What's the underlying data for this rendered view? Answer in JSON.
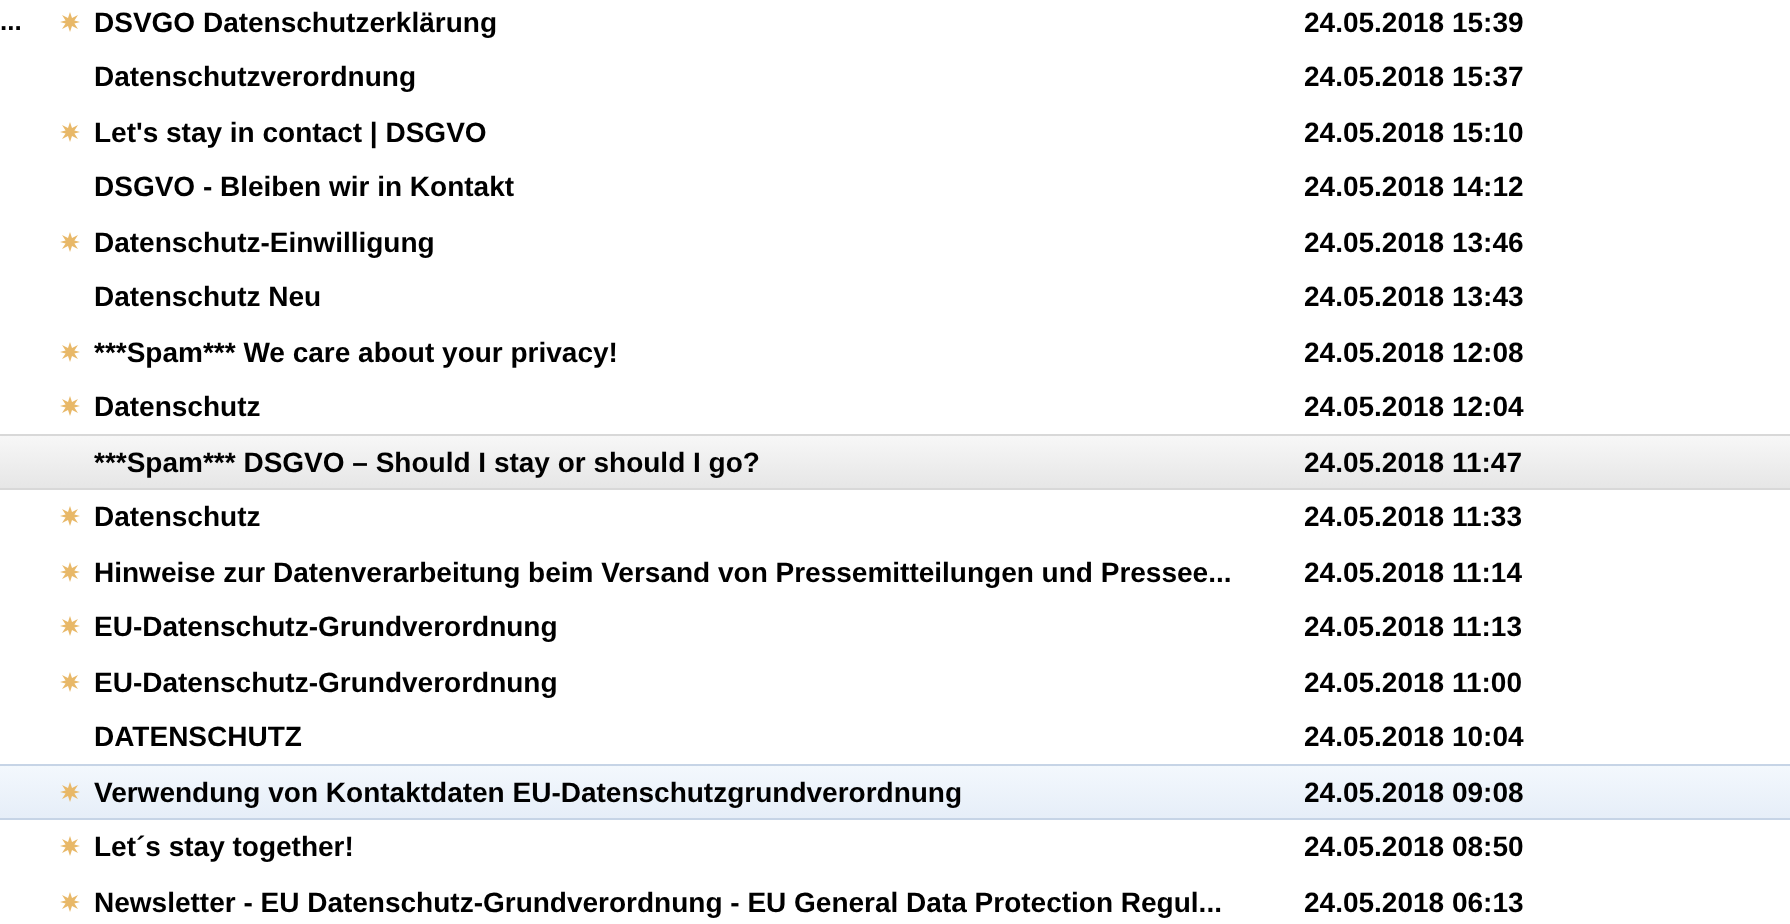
{
  "rows": [
    {
      "column_1": "...",
      "starred": true,
      "subject": "DSVGO Datenschutzerklärung",
      "date": "24.05.2018 15:39",
      "selected": false,
      "hovered": false
    },
    {
      "starred": false,
      "subject": "Datenschutzverordnung",
      "date": "24.05.2018 15:37",
      "selected": false,
      "hovered": false
    },
    {
      "starred": true,
      "subject": "Let's stay in contact | DSGVO",
      "date": "24.05.2018 15:10",
      "selected": false,
      "hovered": false
    },
    {
      "starred": false,
      "subject": "DSGVO - Bleiben wir in Kontakt",
      "date": "24.05.2018 14:12",
      "selected": false,
      "hovered": false
    },
    {
      "starred": true,
      "subject": "Datenschutz-Einwilligung",
      "date": "24.05.2018 13:46",
      "selected": false,
      "hovered": false
    },
    {
      "starred": false,
      "subject": "Datenschutz Neu",
      "date": "24.05.2018 13:43",
      "selected": false,
      "hovered": false
    },
    {
      "starred": true,
      "subject": "***Spam*** We care about your privacy!",
      "date": "24.05.2018 12:08",
      "selected": false,
      "hovered": false
    },
    {
      "starred": true,
      "subject": "Datenschutz",
      "date": "24.05.2018 12:04",
      "selected": false,
      "hovered": false
    },
    {
      "starred": false,
      "subject": "***Spam*** DSGVO – Should I stay or should I go?",
      "date": "24.05.2018 11:47",
      "selected": true,
      "hovered": false
    },
    {
      "starred": true,
      "subject": "Datenschutz",
      "date": "24.05.2018 11:33",
      "selected": false,
      "hovered": false
    },
    {
      "starred": true,
      "subject": "Hinweise zur Datenverarbeitung beim Versand von Pressemitteilungen und Pressee...",
      "date": "24.05.2018 11:14",
      "selected": false,
      "hovered": false
    },
    {
      "starred": true,
      "subject": "EU-Datenschutz-Grundverordnung",
      "date": "24.05.2018 11:13",
      "selected": false,
      "hovered": false
    },
    {
      "starred": true,
      "subject": "EU-Datenschutz-Grundverordnung",
      "date": "24.05.2018 11:00",
      "selected": false,
      "hovered": false
    },
    {
      "starred": false,
      "subject": "DATENSCHUTZ",
      "date": "24.05.2018 10:04",
      "selected": false,
      "hovered": false
    },
    {
      "starred": true,
      "subject": "Verwendung von Kontaktdaten EU-Datenschutzgrundverordnung",
      "date": "24.05.2018 09:08",
      "selected": false,
      "hovered": true
    },
    {
      "starred": true,
      "subject": "Let´s stay together!",
      "date": "24.05.2018 08:50",
      "selected": false,
      "hovered": false
    },
    {
      "starred": true,
      "subject": "Newsletter - EU Datenschutz-Grundverordnung - EU General Data Protection Regul...",
      "date": "24.05.2018 06:13",
      "selected": false,
      "hovered": false
    }
  ]
}
